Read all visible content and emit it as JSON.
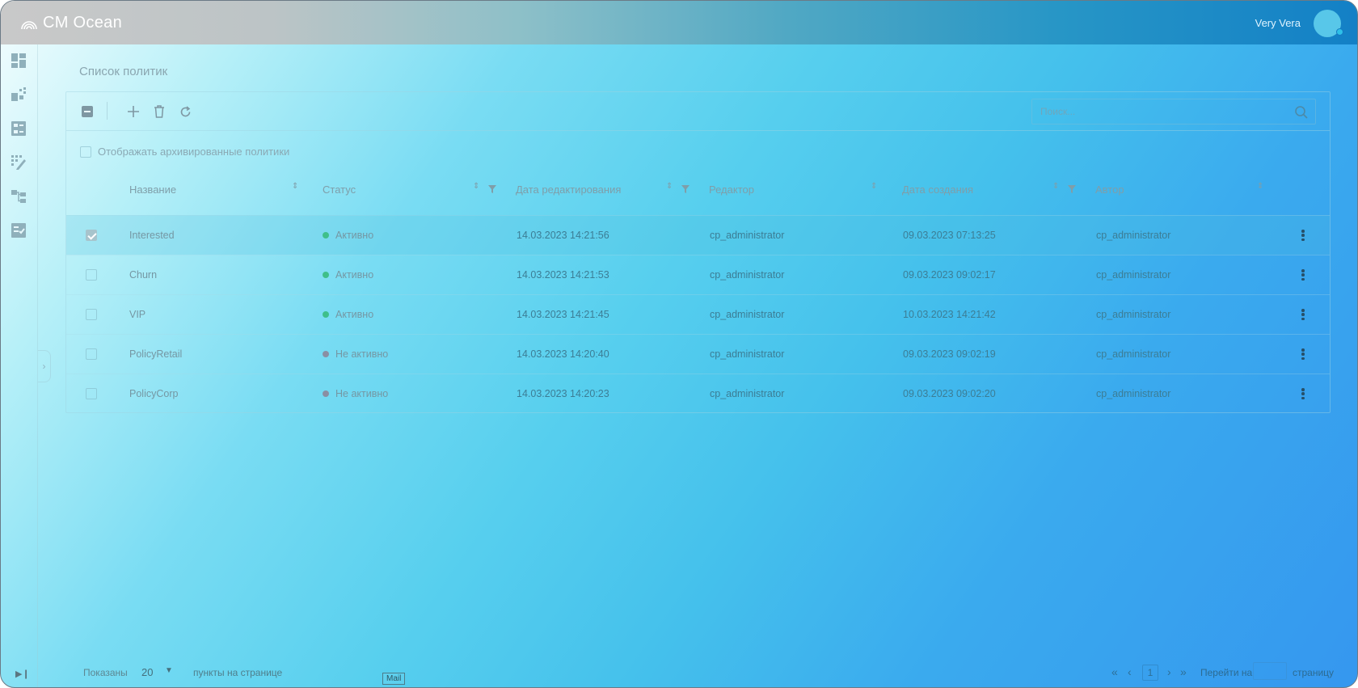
{
  "app": {
    "logo": "CM Ocean"
  },
  "user": {
    "name": "Very Vera"
  },
  "page": {
    "title": "Список политик"
  },
  "search": {
    "placeholder": "Поиск..."
  },
  "archive": {
    "label": "Отображать архивированные политики",
    "checked": false
  },
  "table": {
    "columns": [
      "Название",
      "Статус",
      "Дата редактирования",
      "Редактор",
      "Дата создания",
      "Автор"
    ],
    "rows": [
      {
        "name": "Interested",
        "status": "Активно",
        "status_color": "#3fbf8a",
        "edited": "14.03.2023 14:21:56",
        "editor": "cp_administrator",
        "created": "09.03.2023 07:13:25",
        "author": "cp_administrator",
        "checked": true
      },
      {
        "name": "Churn",
        "status": "Активно",
        "status_color": "#3fbf8a",
        "edited": "14.03.2023 14:21:53",
        "editor": "cp_administrator",
        "created": "09.03.2023 09:02:17",
        "author": "cp_administrator",
        "checked": false
      },
      {
        "name": "VIP",
        "status": "Активно",
        "status_color": "#3fbf8a",
        "edited": "14.03.2023 14:21:45",
        "editor": "cp_administrator",
        "created": "10.03.2023 14:21:42",
        "author": "cp_administrator",
        "checked": false
      },
      {
        "name": "PolicyRetail",
        "status": "Не активно",
        "status_color": "#8a8fa3",
        "edited": "14.03.2023 14:20:40",
        "editor": "cp_administrator",
        "created": "09.03.2023 09:02:19",
        "author": "cp_administrator",
        "checked": false
      },
      {
        "name": "PolicyCorp",
        "status": "Не активно",
        "status_color": "#8a8fa3",
        "edited": "14.03.2023 14:20:23",
        "editor": "cp_administrator",
        "created": "09.03.2023 09:02:20",
        "author": "cp_administrator",
        "checked": false
      }
    ]
  },
  "footer": {
    "shown_label": "Показаны",
    "page_size": "20",
    "units_label": "пункты на странице",
    "mail_tag": "Mail",
    "page": "1",
    "goto_label": "Перейти на",
    "goto_suffix": "страницу"
  },
  "colors": {
    "accent": "#1380c6",
    "active": "#3fbf8a",
    "inactive": "#8a8fa3"
  }
}
